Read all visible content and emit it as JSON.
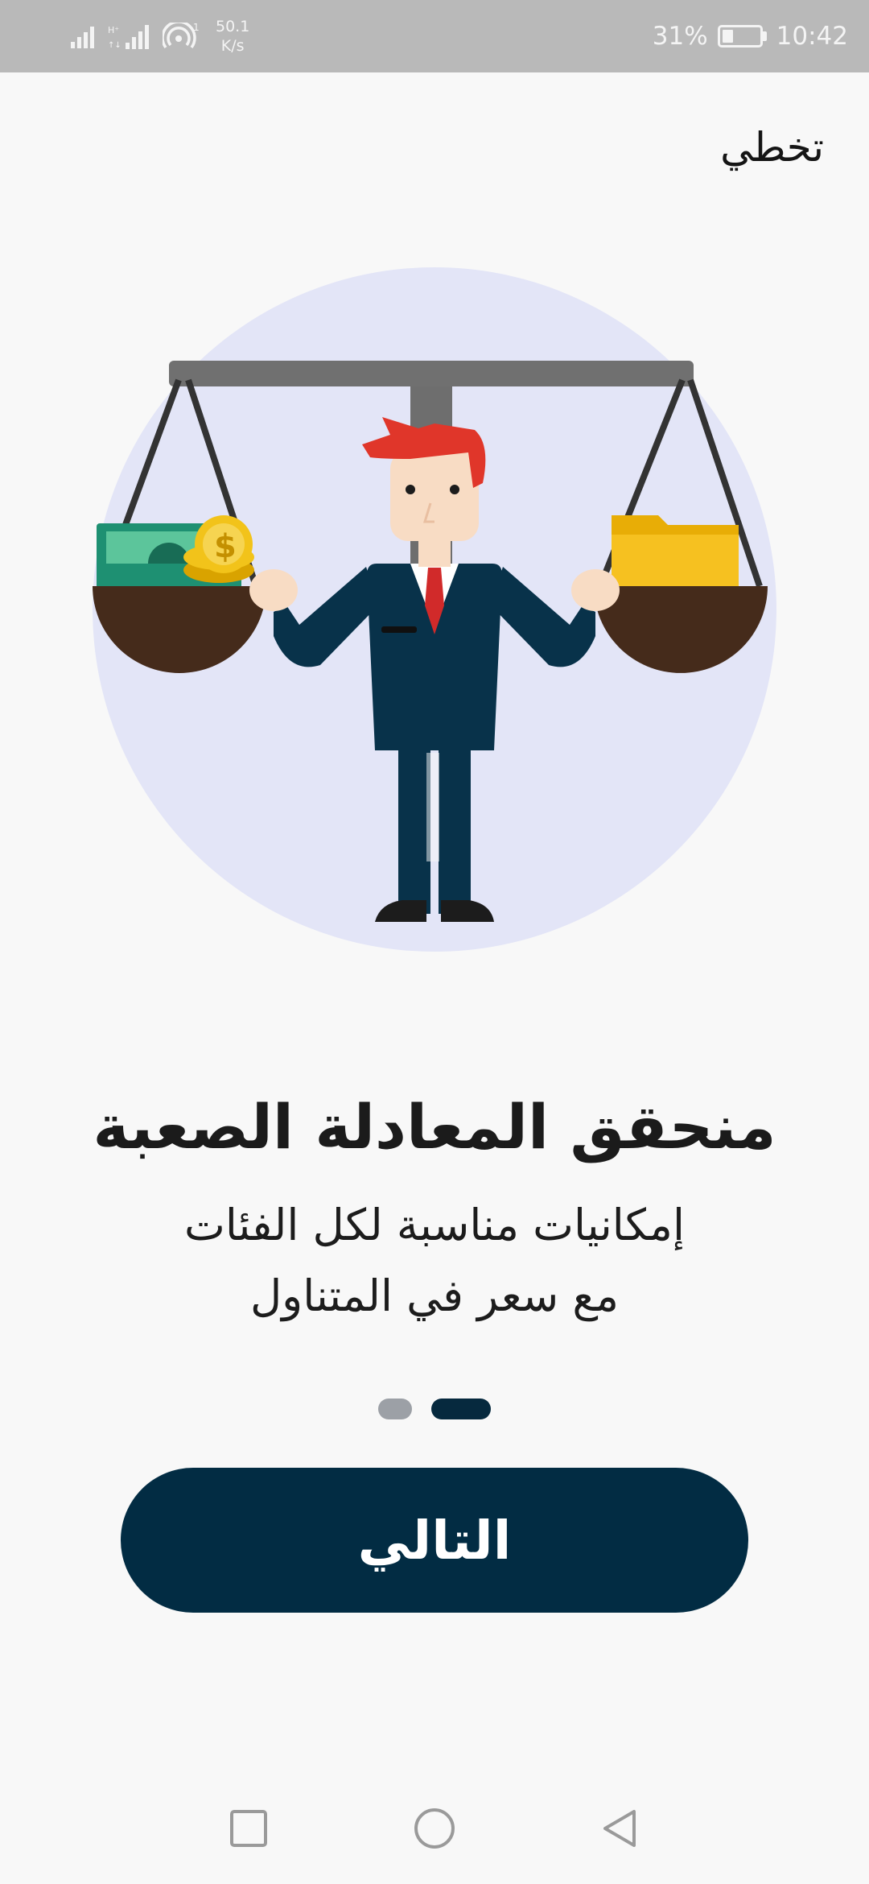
{
  "status_bar": {
    "speed_value": "50.1",
    "speed_unit": "K/s",
    "signal_label": "1",
    "battery_percent": "31%",
    "battery_level": 0.31,
    "time": "10:42"
  },
  "header": {
    "skip_label": "تخطي"
  },
  "slide": {
    "title": "منحقق المعادلة الصعبة",
    "subtitle_line1": "إمكانيات مناسبة لكل الفئات",
    "subtitle_line2": "مع سعر في المتناول"
  },
  "pager": {
    "total": 2,
    "active_index": 1
  },
  "next_button": {
    "label": "التالي"
  },
  "colors": {
    "accent": "#022c43",
    "illustration_bg": "#e3e5f7",
    "dot_inactive": "#9ca0a6",
    "status_bar_bg": "#b9b9b9"
  },
  "icons": {
    "nav_recents": "square-icon",
    "nav_home": "circle-icon",
    "nav_back": "triangle-back-icon"
  }
}
